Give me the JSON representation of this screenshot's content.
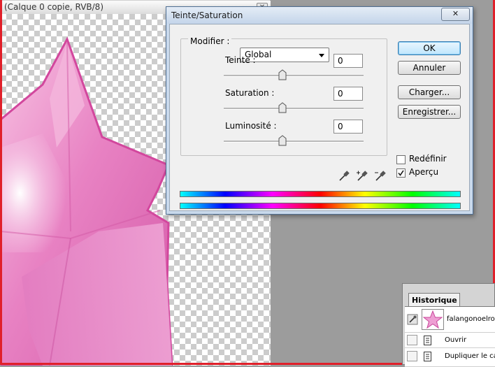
{
  "document": {
    "title": "(Calque 0 copie, RVB/8)",
    "close_glyph": "✕"
  },
  "dialog": {
    "title": "Teinte/Saturation",
    "close_glyph": "✕",
    "modify_label": "Modifier :",
    "modify_value": "Global",
    "params": [
      {
        "label": "Teinte :",
        "value": "0"
      },
      {
        "label": "Saturation :",
        "value": "0"
      },
      {
        "label": "Luminosité :",
        "value": "0"
      }
    ],
    "buttons": {
      "ok": "OK",
      "cancel": "Annuler",
      "load": "Charger...",
      "save": "Enregistrer..."
    },
    "checkboxes": {
      "colorize": {
        "label": "Redéfinir",
        "checked": false
      },
      "preview": {
        "label": "Aperçu",
        "checked": true
      }
    }
  },
  "history": {
    "tab_label": "Historique",
    "snapshot_name": "falangonoelrose",
    "steps": [
      "Ouvrir",
      "Dupliquer le calque"
    ]
  },
  "colors": {
    "star_pink": "#e86bb4",
    "frame_red": "#e0202a",
    "dialog_frame": "#c9d9ec"
  },
  "icons": {
    "dropper_1": "eyedropper-icon",
    "dropper_2": "eyedropper-plus-icon",
    "dropper_3": "eyedropper-minus-icon"
  }
}
